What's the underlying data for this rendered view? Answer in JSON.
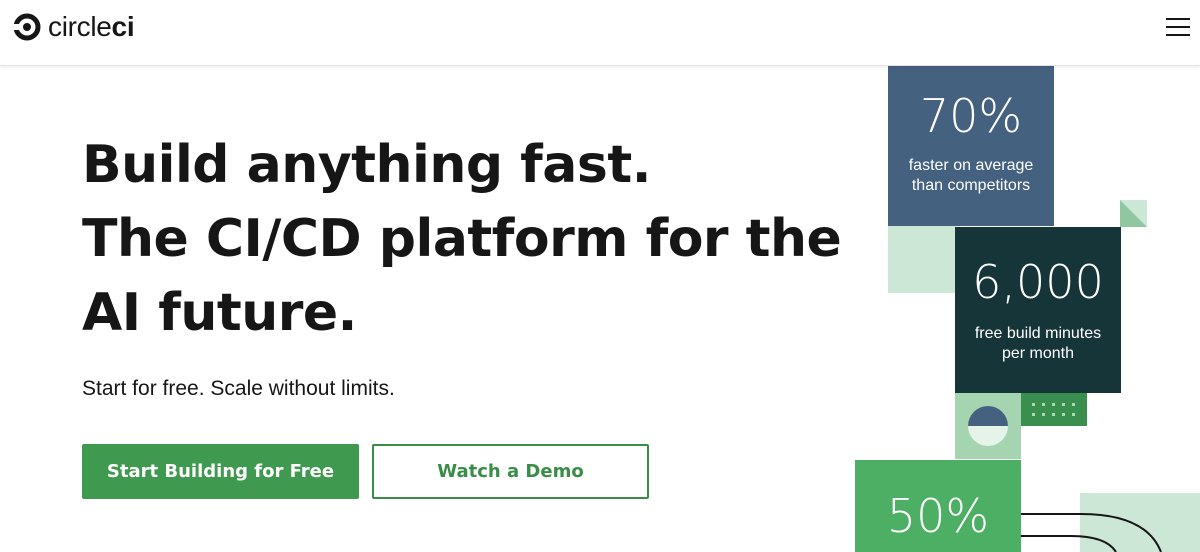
{
  "brand": {
    "name_light": "circle",
    "name_bold": "ci",
    "logo_icon": "circleci-logo-icon"
  },
  "header": {
    "menu_icon": "hamburger-menu-icon"
  },
  "hero": {
    "headline_lines": [
      "Build anything fast.",
      "The CI/CD platform for the",
      "AI future."
    ],
    "subhead": "Start for free. Scale without limits.",
    "primary_cta": "Start Building for Free",
    "secondary_cta": "Watch a Demo"
  },
  "stats": [
    {
      "value": "70%",
      "caption_lines": [
        "faster on average",
        "than competitors"
      ]
    },
    {
      "value": "6,000",
      "caption_lines": [
        "free build minutes",
        "per month"
      ]
    },
    {
      "value": "50%",
      "caption_lines": []
    }
  ],
  "colors": {
    "brand_green": "#3f994f",
    "slate_blue": "#44617f",
    "dark_teal": "#153539",
    "mint": "#cde7d6",
    "mid_green": "#4caf63"
  }
}
